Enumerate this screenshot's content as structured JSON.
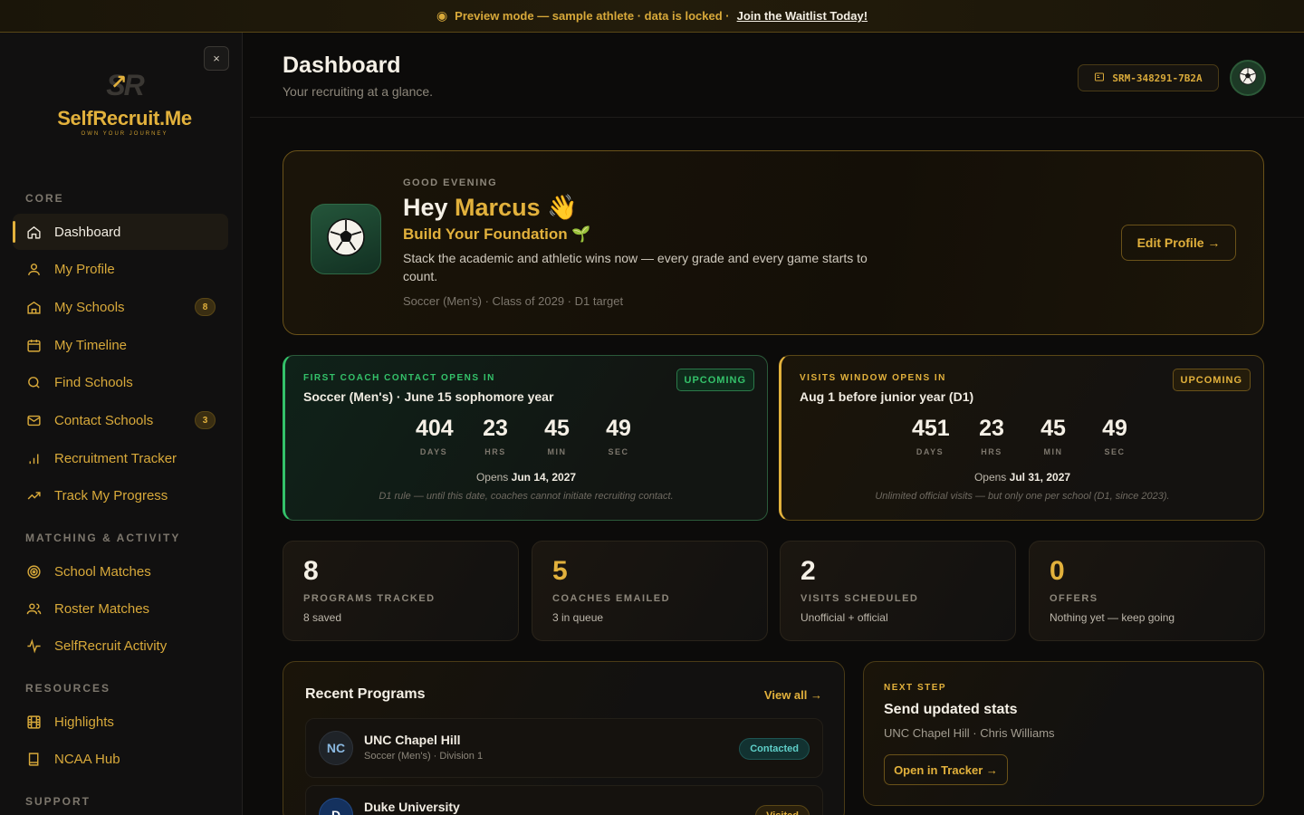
{
  "banner": {
    "text": "Preview mode — sample athlete · data is locked ·",
    "link": "Join the Waitlist Today!"
  },
  "brand": {
    "monogram": "SR",
    "name": "SelfRecruit.Me",
    "tagline": "OWN YOUR JOURNEY",
    "close": "×"
  },
  "sidebar": {
    "sections": {
      "core": "CORE",
      "matching": "MATCHING & ACTIVITY",
      "resources": "RESOURCES",
      "support": "SUPPORT"
    },
    "items": [
      {
        "label": "Dashboard",
        "icon": "home-icon"
      },
      {
        "label": "My Profile",
        "icon": "user-icon"
      },
      {
        "label": "My Schools",
        "icon": "school-icon",
        "badge": "8"
      },
      {
        "label": "My Timeline",
        "icon": "calendar-icon"
      },
      {
        "label": "Find Schools",
        "icon": "search-icon"
      },
      {
        "label": "Contact Schools",
        "icon": "mail-icon",
        "badge": "3"
      },
      {
        "label": "Recruitment Tracker",
        "icon": "bar-chart-icon"
      },
      {
        "label": "Track My Progress",
        "icon": "trend-icon"
      },
      {
        "label": "School Matches",
        "icon": "target-icon"
      },
      {
        "label": "Roster Matches",
        "icon": "users-icon"
      },
      {
        "label": "SelfRecruit Activity",
        "icon": "pulse-icon"
      },
      {
        "label": "Highlights",
        "icon": "film-icon"
      },
      {
        "label": "NCAA Hub",
        "icon": "book-icon"
      }
    ]
  },
  "header": {
    "title": "Dashboard",
    "subtitle": "Your recruiting at a glance.",
    "athlete_id": "SRM-348291-7B2A"
  },
  "hero": {
    "greeting_label": "GOOD EVENING",
    "greeting": "Hey",
    "name": "Marcus",
    "wave": "👋",
    "stage": "Build Your Foundation",
    "stage_icon": "🌱",
    "description": "Stack the academic and athletic wins now — every grade and every game starts to count.",
    "meta": "Soccer (Men's) · Class of 2029 · D1 target",
    "edit_button": "Edit Profile →"
  },
  "countdowns": [
    {
      "label": "FIRST COACH CONTACT OPENS IN",
      "title": "Soccer (Men's) · June 15 sophomore year",
      "pill": "UPCOMING",
      "days": "404",
      "hrs": "23",
      "min": "45",
      "sec": "49",
      "opens_prefix": "Opens",
      "opens_date": "Jun 14, 2027",
      "note": "D1 rule — until this date, coaches cannot initiate recruiting contact."
    },
    {
      "label": "VISITS WINDOW OPENS IN",
      "title": "Aug 1 before junior year (D1)",
      "pill": "UPCOMING",
      "days": "451",
      "hrs": "23",
      "min": "45",
      "sec": "49",
      "opens_prefix": "Opens",
      "opens_date": "Jul 31, 2027",
      "note": "Unlimited official visits — but only one per school (D1, since 2023)."
    }
  ],
  "units": {
    "days": "DAYS",
    "hrs": "HRS",
    "min": "MIN",
    "sec": "SEC"
  },
  "stats": [
    {
      "value": "8",
      "label": "PROGRAMS TRACKED",
      "sub": "8 saved"
    },
    {
      "value": "5",
      "label": "COACHES EMAILED",
      "sub": "3 in queue"
    },
    {
      "value": "2",
      "label": "VISITS SCHEDULED",
      "sub": "Unofficial + official"
    },
    {
      "value": "0",
      "label": "OFFERS",
      "sub": "Nothing yet — keep going"
    }
  ],
  "recent": {
    "title": "Recent Programs",
    "view_all": "View all →",
    "programs": [
      {
        "initials": "NC",
        "name": "UNC Chapel Hill",
        "meta": "Soccer (Men's) · Division 1",
        "status": "Contacted"
      },
      {
        "initials": "D",
        "name": "Duke University",
        "meta": "",
        "status": "Visited"
      }
    ]
  },
  "next_step": {
    "label": "NEXT STEP",
    "title": "Send updated stats",
    "subtitle": "UNC Chapel Hill · Chris Williams",
    "button": "Open in Tracker →"
  },
  "colors": {
    "accent": "#e2b13c",
    "success": "#34c26a",
    "background": "#0c0b0a"
  }
}
